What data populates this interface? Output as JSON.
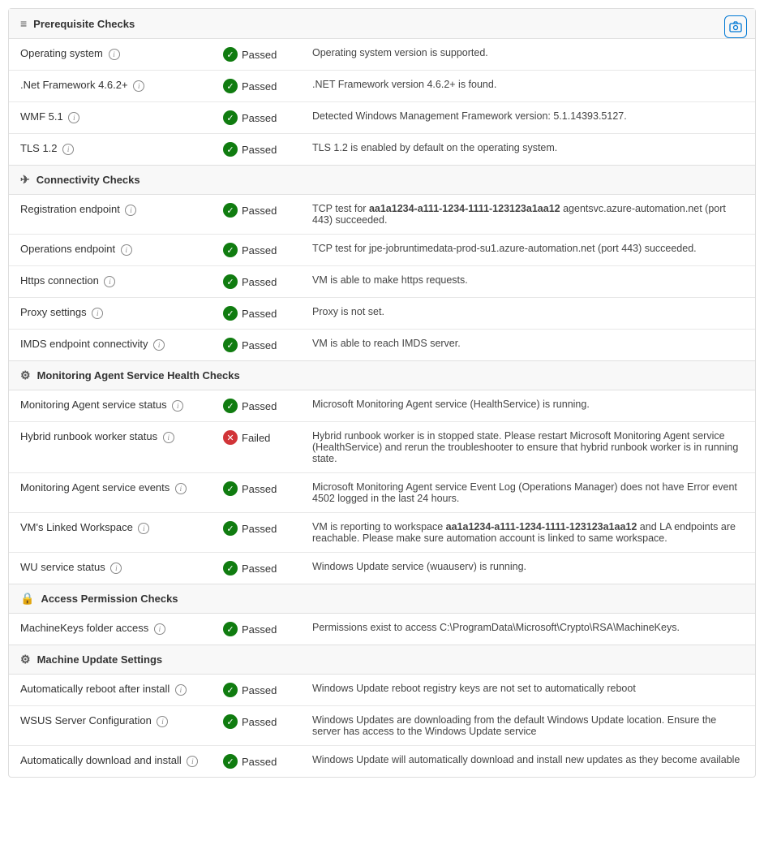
{
  "sections": [
    {
      "id": "prerequisite",
      "icon": "≡",
      "title": "Prerequisite Checks",
      "rows": [
        {
          "name": "Operating system",
          "hasInfo": true,
          "status": "Passed",
          "statusType": "passed",
          "description": "Operating system version is supported."
        },
        {
          "name": ".Net Framework 4.6.2+",
          "hasInfo": true,
          "status": "Passed",
          "statusType": "passed",
          "description": ".NET Framework version 4.6.2+ is found."
        },
        {
          "name": "WMF 5.1",
          "hasInfo": true,
          "status": "Passed",
          "statusType": "passed",
          "description": "Detected Windows Management Framework version: 5.1.14393.5127."
        },
        {
          "name": "TLS 1.2",
          "hasInfo": true,
          "status": "Passed",
          "statusType": "passed",
          "description": "TLS 1.2 is enabled by default on the operating system."
        }
      ]
    },
    {
      "id": "connectivity",
      "icon": "⊕",
      "title": "Connectivity Checks",
      "rows": [
        {
          "name": "Registration endpoint",
          "hasInfo": true,
          "status": "Passed",
          "statusType": "passed",
          "description": "TCP test for aa1a1234-a111-1234-1111-123123a1aa12 agentsvc.azure-automation.net (port 443) succeeded.",
          "boldParts": [
            "aa1a1234-a111-1234-1111-123123a1aa12"
          ]
        },
        {
          "name": "Operations endpoint",
          "hasInfo": true,
          "status": "Passed",
          "statusType": "passed",
          "description": "TCP test for jpe-jobruntimedata-prod-su1.azure-automation.net (port 443) succeeded."
        },
        {
          "name": "Https connection",
          "hasInfo": true,
          "status": "Passed",
          "statusType": "passed",
          "description": "VM is able to make https requests."
        },
        {
          "name": "Proxy settings",
          "hasInfo": true,
          "status": "Passed",
          "statusType": "passed",
          "description": "Proxy is not set."
        },
        {
          "name": "IMDS endpoint connectivity",
          "hasInfo": true,
          "status": "Passed",
          "statusType": "passed",
          "description": "VM is able to reach IMDS server."
        }
      ]
    },
    {
      "id": "monitoring",
      "icon": "⚙",
      "title": "Monitoring Agent Service Health Checks",
      "rows": [
        {
          "name": "Monitoring Agent service status",
          "hasInfo": true,
          "status": "Passed",
          "statusType": "passed",
          "description": "Microsoft Monitoring Agent service (HealthService) is running."
        },
        {
          "name": "Hybrid runbook worker status",
          "hasInfo": true,
          "status": "Failed",
          "statusType": "failed",
          "description": "Hybrid runbook worker is in stopped state. Please restart Microsoft Monitoring Agent service (HealthService) and rerun the troubleshooter to ensure that hybrid runbook worker is in running state."
        },
        {
          "name": "Monitoring Agent service events",
          "hasInfo": true,
          "status": "Passed",
          "statusType": "passed",
          "description": "Microsoft Monitoring Agent service Event Log (Operations Manager) does not have Error event 4502 logged in the last 24 hours."
        },
        {
          "name": "VM's Linked Workspace",
          "hasInfo": true,
          "status": "Passed",
          "statusType": "passed",
          "description": "VM is reporting to workspace aa1a1234-a111-1234-1111-123123a1aa12 and LA endpoints are reachable. Please make sure automation account is linked to same workspace.",
          "boldParts": [
            "aa1a1234-a111-1234-1111-123123a1aa12"
          ]
        },
        {
          "name": "WU service status",
          "hasInfo": true,
          "status": "Passed",
          "statusType": "passed",
          "description": "Windows Update service (wuauserv) is running."
        }
      ]
    },
    {
      "id": "access",
      "icon": "🔒",
      "title": "Access Permission Checks",
      "rows": [
        {
          "name": "MachineKeys folder access",
          "hasInfo": true,
          "status": "Passed",
          "statusType": "passed",
          "description": "Permissions exist to access C:\\ProgramData\\Microsoft\\Crypto\\RSA\\MachineKeys."
        }
      ]
    },
    {
      "id": "machineupdate",
      "icon": "⚙",
      "title": "Machine Update Settings",
      "rows": [
        {
          "name": "Automatically reboot after install",
          "hasInfo": true,
          "status": "Passed",
          "statusType": "passed",
          "description": "Windows Update reboot registry keys are not set to automatically reboot"
        },
        {
          "name": "WSUS Server Configuration",
          "hasInfo": true,
          "status": "Passed",
          "statusType": "passed",
          "description": "Windows Updates are downloading from the default Windows Update location. Ensure the server has access to the Windows Update service"
        },
        {
          "name": "Automatically download and install",
          "hasInfo": true,
          "status": "Passed",
          "statusType": "passed",
          "description": "Windows Update will automatically download and install new updates as they become available"
        }
      ]
    }
  ],
  "camera_title": "Take screenshot",
  "info_label": "i",
  "passed_label": "Passed",
  "failed_label": "Failed"
}
